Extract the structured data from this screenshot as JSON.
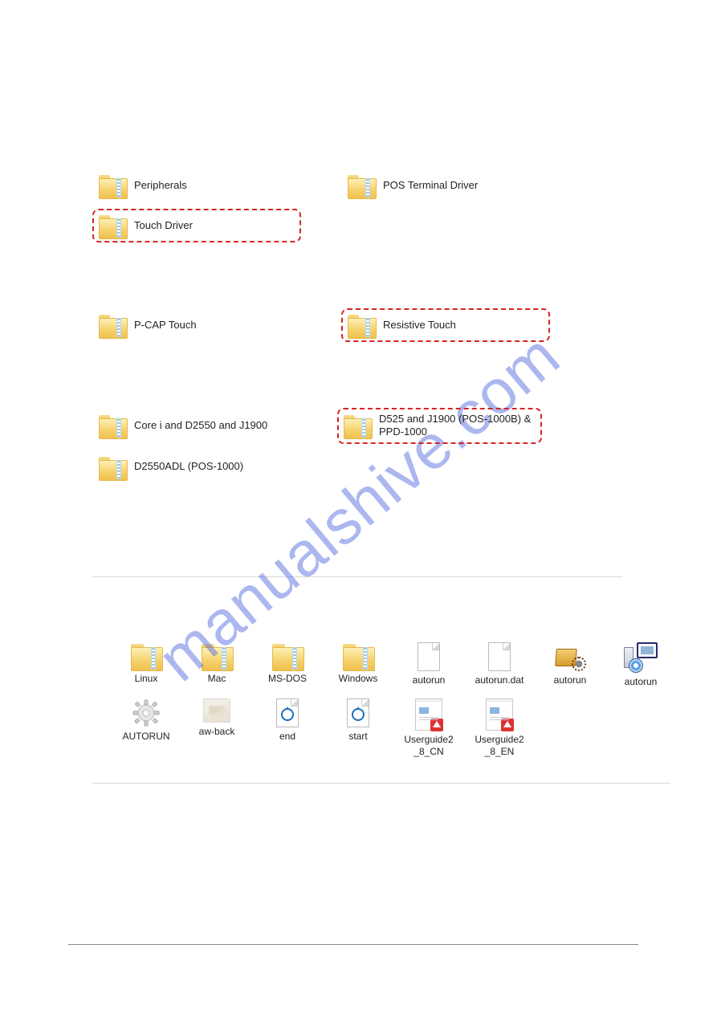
{
  "watermark": "manualshive.com",
  "section1": {
    "items": [
      {
        "label": "Peripherals",
        "highlight": false
      },
      {
        "label": "POS Terminal Driver",
        "highlight": false
      },
      {
        "label": "Touch Driver",
        "highlight": true
      }
    ]
  },
  "section2": {
    "items": [
      {
        "label": "P-CAP Touch",
        "highlight": false
      },
      {
        "label": "Resistive Touch",
        "highlight": true
      }
    ]
  },
  "section3": {
    "items": [
      {
        "label": "Core i and D2550 and J1900",
        "highlight": false
      },
      {
        "label": "D525 and J1900 (POS-1000B) & PPD-1000",
        "highlight": true
      },
      {
        "label": "D2550ADL (POS-1000)",
        "highlight": false
      }
    ]
  },
  "grid": {
    "row1": [
      {
        "type": "folder",
        "label": "Linux"
      },
      {
        "type": "folder",
        "label": "Mac"
      },
      {
        "type": "folder",
        "label": "MS-DOS"
      },
      {
        "type": "folder",
        "label": "Windows"
      },
      {
        "type": "blank",
        "label": "autorun"
      },
      {
        "type": "blank",
        "label": "autorun.dat"
      },
      {
        "type": "installer",
        "label": "autorun"
      },
      {
        "type": "pcsetup",
        "label": "autorun"
      }
    ],
    "row2": [
      {
        "type": "gear",
        "label": "AUTORUN"
      },
      {
        "type": "photo",
        "label": "aw-back"
      },
      {
        "type": "disc",
        "label": "end"
      },
      {
        "type": "disc",
        "label": "start"
      },
      {
        "type": "pdf",
        "label": "Userguide2_8_CN"
      },
      {
        "type": "pdf",
        "label": "Userguide2_8_EN"
      }
    ]
  }
}
